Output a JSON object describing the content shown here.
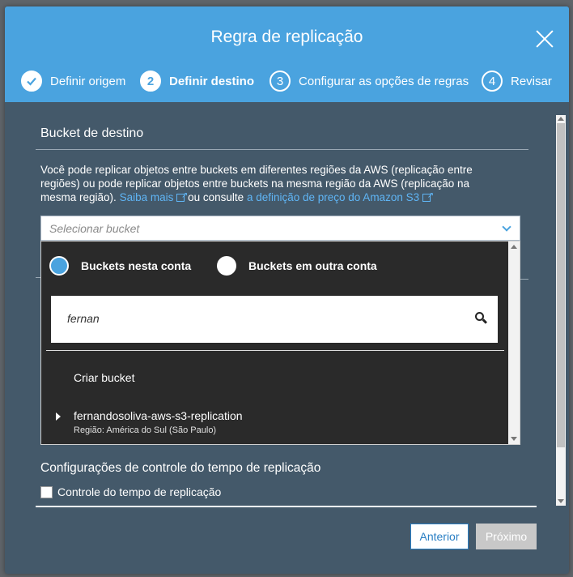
{
  "modal": {
    "title": "Regra de replicação"
  },
  "steps": [
    {
      "number": "",
      "label": "Definir origem",
      "state": "done"
    },
    {
      "number": "2",
      "label": "Definir destino",
      "state": "active"
    },
    {
      "number": "3",
      "label": "Configurar as opções de regras",
      "state": "pending"
    },
    {
      "number": "4",
      "label": "Revisar",
      "state": "pending"
    }
  ],
  "destination": {
    "section_title": "Bucket de destino",
    "description_text": "Você pode replicar objetos entre buckets em diferentes regiões da AWS (replicação entre regiões) ou pode replicar objetos entre buckets na mesma região da AWS (replicação na mesma região).",
    "learn_more_link": "Saiba mais",
    "or_text": "ou consulte",
    "pricing_link": "a definição de preço do Amazon S3",
    "select_placeholder": "Selecionar bucket"
  },
  "dropdown": {
    "radio_this_account": "Buckets nesta conta",
    "radio_other_account": "Buckets em outra conta",
    "search_value": "fernan",
    "create_bucket": "Criar bucket",
    "buckets": [
      {
        "name": "fernandosoliva-aws-s3-replication",
        "region": "Região: América do Sul (São Paulo)"
      }
    ]
  },
  "rtc": {
    "section_title": "Configurações de controle do tempo de replicação",
    "checkbox_label": "Controle do tempo de replicação"
  },
  "footer": {
    "prev_label": "Anterior",
    "next_label": "Próximo"
  },
  "colors": {
    "header_bg": "#4aa3df",
    "body_bg": "#44596a",
    "link": "#5fb5f5",
    "dropdown_bg": "#2a2a2a"
  }
}
